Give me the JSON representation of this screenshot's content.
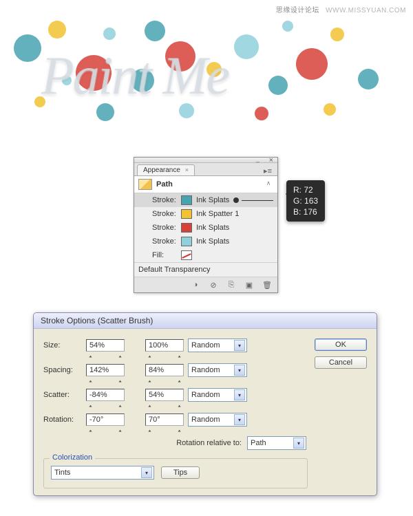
{
  "watermark": {
    "cn": "思缘设计论坛",
    "url": "WWW.MISSYUAN.COM"
  },
  "hero": {
    "text": "Paint Me"
  },
  "appearance": {
    "tab": "Appearance",
    "path_label": "Path",
    "rows": [
      {
        "label": "Stroke:",
        "brush": "Ink Splats",
        "color": "#48A3B0"
      },
      {
        "label": "Stroke:",
        "brush": "Ink Spatter 1",
        "color": "#F2C233"
      },
      {
        "label": "Stroke:",
        "brush": "Ink Splats",
        "color": "#D6423A"
      },
      {
        "label": "Stroke:",
        "brush": "Ink Splats",
        "color": "#8FD0DB"
      },
      {
        "label": "Fill:",
        "brush": "",
        "color": "none"
      }
    ],
    "default_transparency": "Default Transparency"
  },
  "rgb": {
    "r_label": "R:",
    "r": "72",
    "g_label": "G:",
    "g": "163",
    "b_label": "B:",
    "b": "176"
  },
  "dialog": {
    "title": "Stroke Options (Scatter Brush)",
    "size_label": "Size:",
    "size_a": "54%",
    "size_b": "100%",
    "size_mode": "Random",
    "spacing_label": "Spacing:",
    "spacing_a": "142%",
    "spacing_b": "84%",
    "spacing_mode": "Random",
    "scatter_label": "Scatter:",
    "scatter_a": "-84%",
    "scatter_b": "54%",
    "scatter_mode": "Random",
    "rotation_label": "Rotation:",
    "rotation_a": "-70°",
    "rotation_b": "70°",
    "rotation_mode": "Random",
    "rot_rel_label": "Rotation relative to:",
    "rot_rel_value": "Path",
    "colorization_legend": "Colorization",
    "colorization_value": "Tints",
    "tips_label": "Tips",
    "ok_label": "OK",
    "cancel_label": "Cancel"
  }
}
